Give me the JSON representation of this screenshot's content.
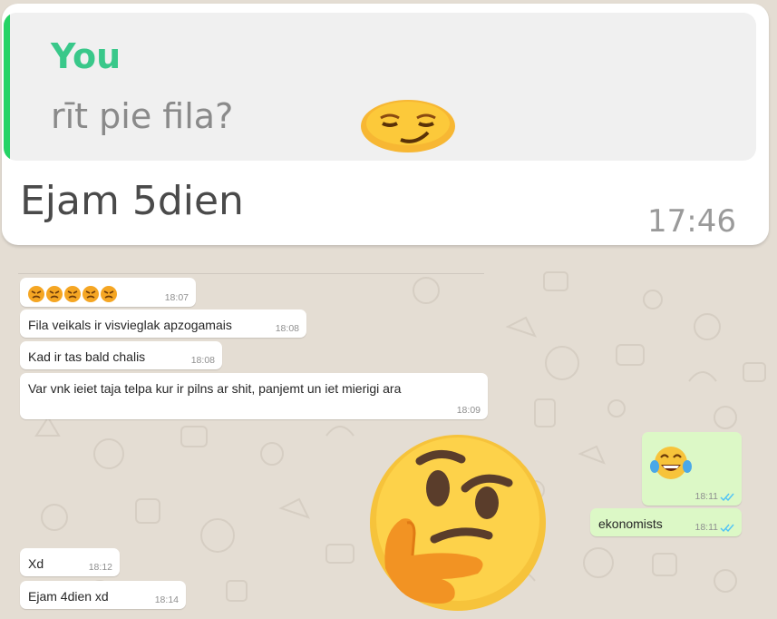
{
  "quoted_reply": {
    "author": "You",
    "text": "rīt pie fila?",
    "emoji": "smirking-face",
    "message": "Ejam 5dien",
    "time": "17:46"
  },
  "messages": [
    {
      "direction": "in",
      "text": "",
      "emoji": [
        "angry-face",
        "angry-face",
        "angry-face",
        "angry-face",
        "angry-face"
      ],
      "time": "18:07"
    },
    {
      "direction": "in",
      "text": "Fila veikals ir visvieglak apzogamais",
      "time": "18:08"
    },
    {
      "direction": "in",
      "text": "Kad ir tas bald chalis",
      "time": "18:08"
    },
    {
      "direction": "in",
      "text": "Var vnk ieiet taja telpa kur ir pilns ar shit, panjemt un iet mierigi ara",
      "time": "18:09"
    },
    {
      "direction": "out",
      "text": "",
      "emoji": [
        "face-with-tears-of-joy"
      ],
      "time": "18:11",
      "status": "read"
    },
    {
      "direction": "out",
      "text": "ekonomists",
      "time": "18:11",
      "status": "read"
    },
    {
      "direction": "in",
      "text": "Xd",
      "time": "18:12"
    },
    {
      "direction": "in",
      "text": "Ejam 4dien xd",
      "time": "18:14"
    }
  ],
  "sticker": "thinking-face",
  "colors": {
    "wallpaper": "#e4ddd3",
    "outgoing_bubble": "#dcf8c6",
    "incoming_bubble": "#ffffff",
    "quote_accent": "#25d366",
    "read_ticks": "#4fc3f7"
  }
}
